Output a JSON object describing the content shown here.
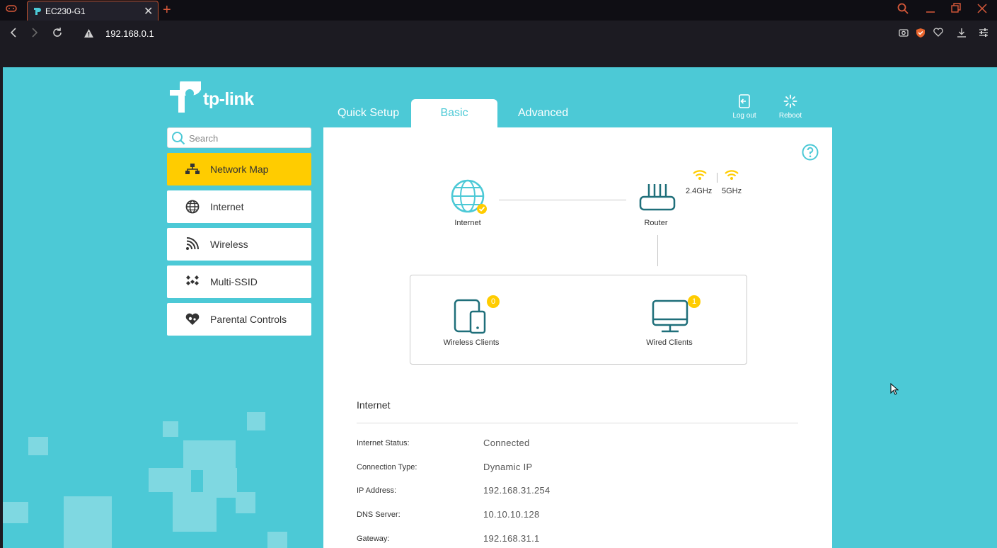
{
  "browser": {
    "tab_title": "EC230-G1",
    "url": "192.168.0.1"
  },
  "brand": {
    "logo_text": "tp-link",
    "accent": "#4cc9d6",
    "highlight": "#ffcc00"
  },
  "nav_tabs": [
    {
      "label": "Quick Setup",
      "active": false
    },
    {
      "label": "Basic",
      "active": true
    },
    {
      "label": "Advanced",
      "active": false
    }
  ],
  "top_buttons": {
    "logout_label": "Log out",
    "reboot_label": "Reboot"
  },
  "search": {
    "placeholder": "Search"
  },
  "sidebar": {
    "items": [
      {
        "label": "Network Map",
        "icon": "network-map-icon",
        "active": true
      },
      {
        "label": "Internet",
        "icon": "globe-icon",
        "active": false
      },
      {
        "label": "Wireless",
        "icon": "wireless-icon",
        "active": false
      },
      {
        "label": "Multi-SSID",
        "icon": "multi-ssid-icon",
        "active": false
      },
      {
        "label": "Parental Controls",
        "icon": "parental-controls-icon",
        "active": false
      }
    ]
  },
  "network_map": {
    "internet_label": "Internet",
    "router_label": "Router",
    "band_24": "2.4GHz",
    "band_5": "5GHz",
    "wireless_clients_label": "Wireless Clients",
    "wireless_clients_count": "0",
    "wired_clients_label": "Wired Clients",
    "wired_clients_count": "1"
  },
  "internet_section": {
    "title": "Internet",
    "rows": [
      {
        "label": "Internet Status:",
        "value": "Connected"
      },
      {
        "label": "Connection Type:",
        "value": "Dynamic IP"
      },
      {
        "label": "IP Address:",
        "value": "192.168.31.254"
      },
      {
        "label": "DNS Server:",
        "value": "10.10.10.128"
      },
      {
        "label": "Gateway:",
        "value": "192.168.31.1"
      }
    ]
  }
}
